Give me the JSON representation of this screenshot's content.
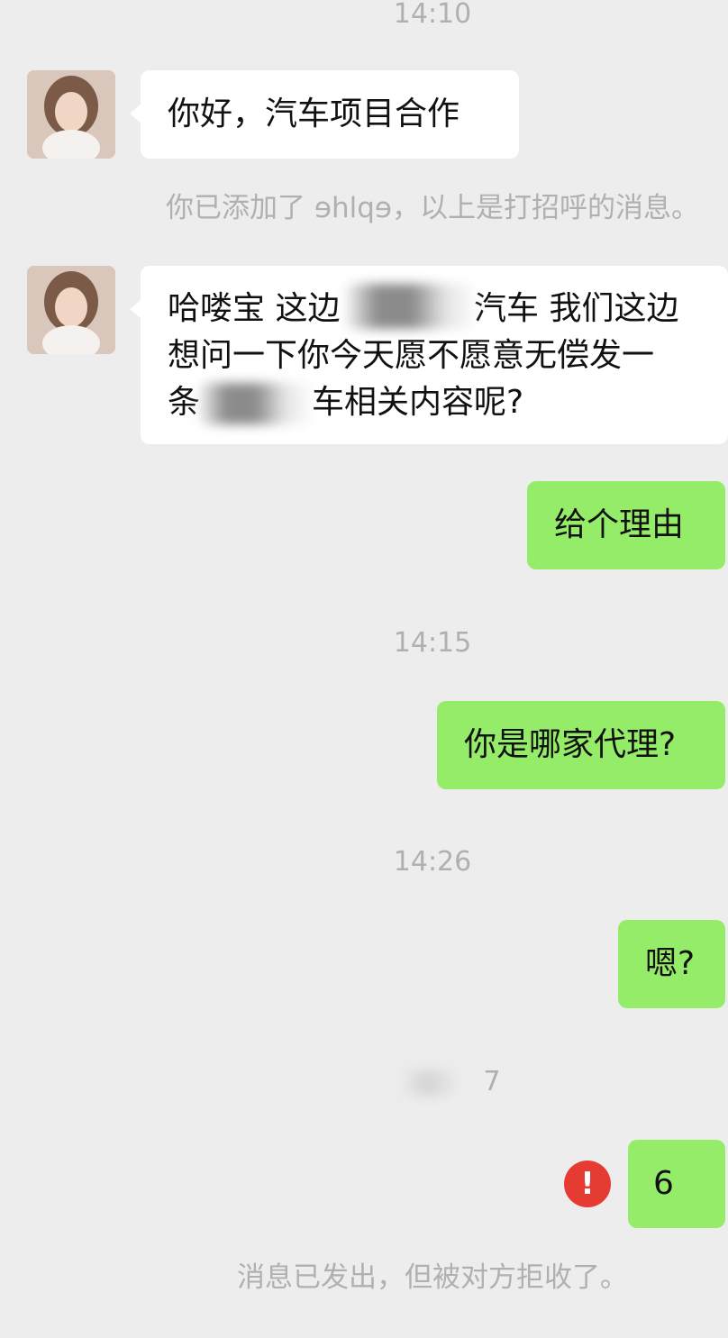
{
  "chat": {
    "times": {
      "t1": "14:10",
      "t2": "14:15",
      "t3": "14:26",
      "t4": "7"
    },
    "system": {
      "added": "你已添加了 ɘhlqɘ，以上是打招呼的消息。",
      "rejected": "消息已发出，但被对方拒收了。"
    },
    "messages": {
      "m1": "你好，汽车项目合作",
      "m2_line1": "哈喽宝 这边",
      "m2_line1b": "汽车 我们这边",
      "m2_line2": "想问一下你今天愿不愿意无偿发一",
      "m2_line3a": "条",
      "m2_line3b": "车相关内容呢?",
      "m3": "给个理由",
      "m4": "你是哪家代理?",
      "m5": "嗯?",
      "m6": "6"
    },
    "error_icon": "!"
  },
  "colors": {
    "background": "#ededed",
    "incoming_bubble": "#ffffff",
    "outgoing_bubble": "#95ec69",
    "error": "#e63b33",
    "meta_text": "#b0b0b0"
  }
}
